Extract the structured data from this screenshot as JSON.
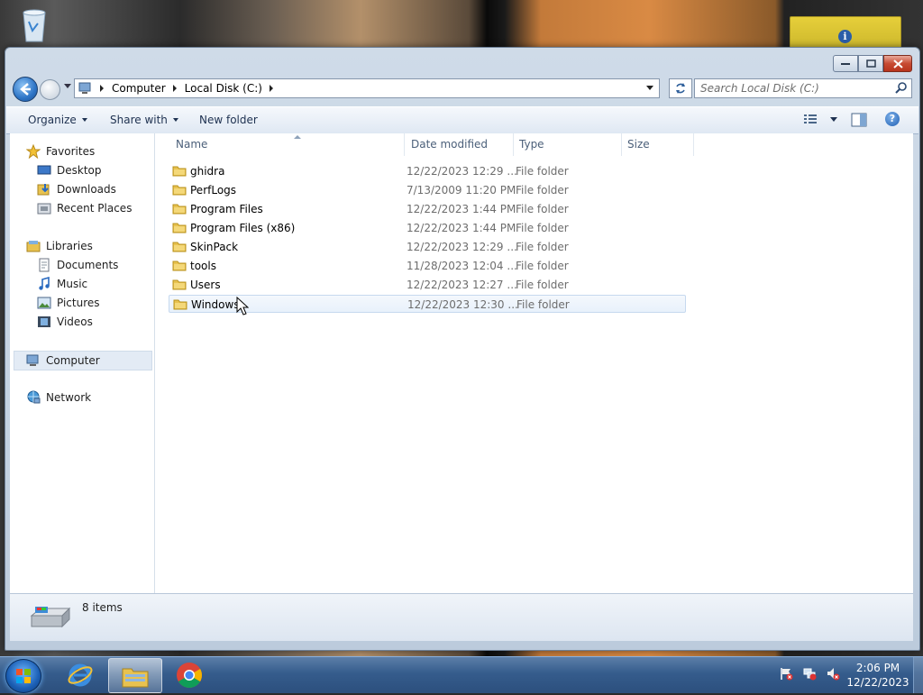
{
  "address": {
    "crumbs": [
      "Computer",
      "Local Disk (C:)"
    ]
  },
  "search": {
    "placeholder": "Search Local Disk (C:)"
  },
  "toolbar": {
    "organize": "Organize",
    "share_with": "Share with",
    "new_folder": "New folder"
  },
  "nav": {
    "favorites": "Favorites",
    "desktop": "Desktop",
    "downloads": "Downloads",
    "recent_places": "Recent Places",
    "libraries": "Libraries",
    "documents": "Documents",
    "music": "Music",
    "pictures": "Pictures",
    "videos": "Videos",
    "computer": "Computer",
    "network": "Network"
  },
  "columns": {
    "name": "Name",
    "date_modified": "Date modified",
    "type": "Type",
    "size": "Size"
  },
  "files": [
    {
      "name": "ghidra",
      "date": "12/22/2023 12:29 ...",
      "type": "File folder"
    },
    {
      "name": "PerfLogs",
      "date": "7/13/2009 11:20 PM",
      "type": "File folder"
    },
    {
      "name": "Program Files",
      "date": "12/22/2023 1:44 PM",
      "type": "File folder"
    },
    {
      "name": "Program Files (x86)",
      "date": "12/22/2023 1:44 PM",
      "type": "File folder"
    },
    {
      "name": "SkinPack",
      "date": "12/22/2023 12:29 ...",
      "type": "File folder"
    },
    {
      "name": "tools",
      "date": "11/28/2023 12:04 ...",
      "type": "File folder"
    },
    {
      "name": "Users",
      "date": "12/22/2023 12:27 ...",
      "type": "File folder"
    },
    {
      "name": "Windows",
      "date": "12/22/2023 12:30 ...",
      "type": "File folder"
    }
  ],
  "details": {
    "item_count": "8 items"
  },
  "taskbar": {
    "time": "2:06 PM",
    "date": "12/22/2023"
  },
  "colors": {
    "accent": "#2d74c6",
    "folder": "#e8c250",
    "taskbar": "#355c8c"
  }
}
